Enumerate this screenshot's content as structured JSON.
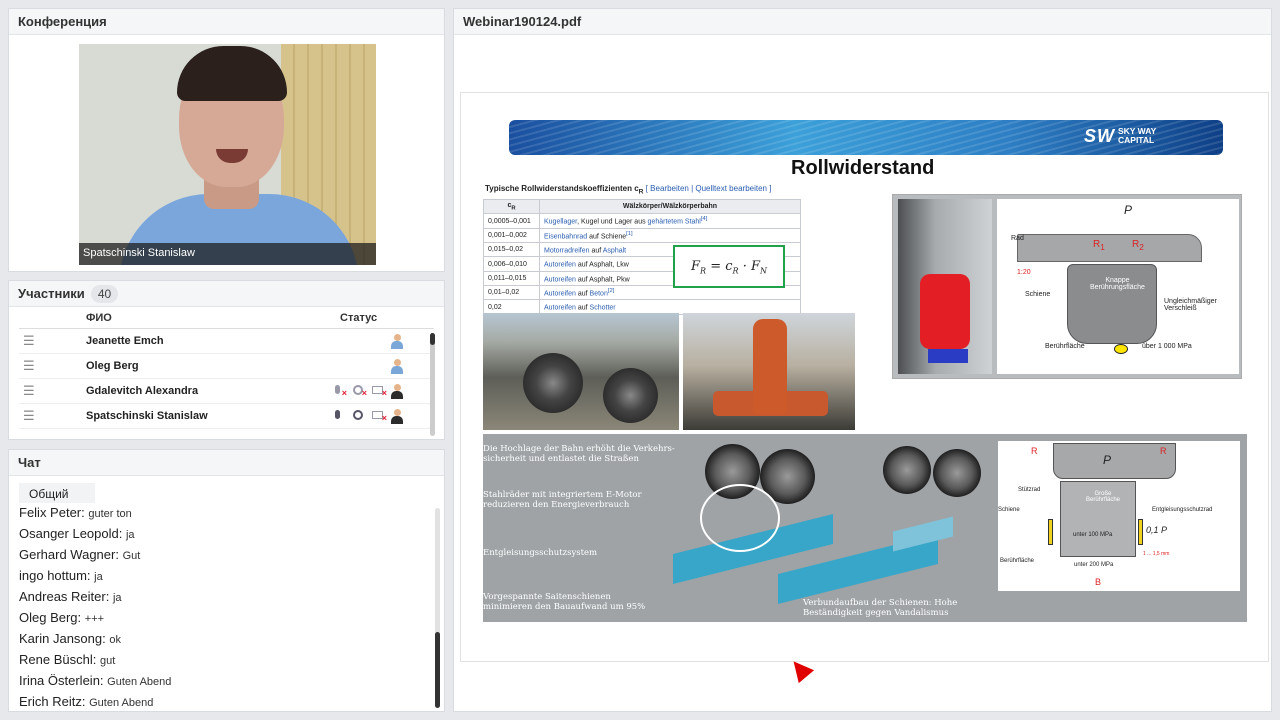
{
  "conference": {
    "title": "Конференция",
    "video_caption": "Spatschinski Stanislaw"
  },
  "participants": {
    "title": "Участники",
    "count": "40",
    "col_name": "ФИО",
    "col_status": "Статус",
    "rows": [
      {
        "name": "Jeanette Emch",
        "mic": false,
        "cam": false,
        "screen": false
      },
      {
        "name": "Oleg Berg",
        "mic": false,
        "cam": false,
        "screen": false
      },
      {
        "name": "Gdalevitch Alexandra",
        "mic": "muted",
        "cam": "off",
        "screen": "off"
      },
      {
        "name": "Spatschinski Stanislaw",
        "mic": "on",
        "cam": "on",
        "screen": "off"
      }
    ]
  },
  "chat": {
    "title": "Чат",
    "tab": "Общий",
    "messages": [
      {
        "who": "Felix Peter:",
        "msg": "guter ton"
      },
      {
        "who": "Osanger Leopold:",
        "msg": "ja"
      },
      {
        "who": "Gerhard Wagner:",
        "msg": "Gut"
      },
      {
        "who": "ingo hottum:",
        "msg": "ja"
      },
      {
        "who": "Andreas Reiter:",
        "msg": "ja"
      },
      {
        "who": "Oleg Berg:",
        "msg": "+++"
      },
      {
        "who": "Karin Jansong:",
        "msg": "ok"
      },
      {
        "who": "Rene Büschl:",
        "msg": "gut"
      },
      {
        "who": "Irina Österlein:",
        "msg": "Guten Abend"
      },
      {
        "who": "Erich Reitz:",
        "msg": "Guten Abend"
      }
    ]
  },
  "pdf": {
    "title": "Webinar190124.pdf",
    "slide": {
      "logo_mark": "SW",
      "logo_line1": "SKY WAY",
      "logo_line2": "CAPITAL",
      "title": "Rollwiderstand",
      "table_title": "Typische Rollwiderstandskoeffizienten c",
      "table_title_sub": "R",
      "table_links": "[ Bearbeiten | Quelltext bearbeiten ]",
      "table_head_c": "c",
      "table_head_c_sub": "R",
      "table_head_pair": "Wälzkörper/Wälzkörperbahn",
      "table_rows": [
        {
          "c": "0,0005–0,001",
          "link": "Kugellager",
          "rest": ", Kugel und Lager aus ",
          "link2": "gehärtetem Stahl",
          "sup": "[4]"
        },
        {
          "c": "0,001–0,002",
          "link": "Eisenbahnrad",
          "rest": " auf Schiene",
          "link2": "",
          "sup": "[1]"
        },
        {
          "c": "0,015–0,02",
          "link": "Motorradreifen",
          "rest": " auf ",
          "link2": "Asphalt",
          "sup": ""
        },
        {
          "c": "0,006–0,010",
          "link": "Autoreifen",
          "rest": " auf Asphalt, Lkw",
          "link2": "",
          "sup": ""
        },
        {
          "c": "0,011–0,015",
          "link": "Autoreifen",
          "rest": " auf Asphalt, Pkw",
          "link2": "",
          "sup": ""
        },
        {
          "c": "0,01–0,02",
          "link": "Autoreifen",
          "rest": " auf ",
          "link2": "Beton",
          "sup": "[2]"
        },
        {
          "c": "0,02",
          "link": "Autoreifen",
          "rest": " auf ",
          "link2": "Schotter",
          "sup": ""
        }
      ],
      "formula_lhs": "F",
      "formula_lhs_sub": "R",
      "formula_mid": "= c",
      "formula_mid_sub": "R",
      "formula_rhs": "· F",
      "formula_rhs_sub": "N",
      "diagram1": {
        "p": "P",
        "rad": "Rad",
        "r1": "R",
        "r1_sub": "1",
        "r2": "R",
        "r2_sub": "2",
        "ratio": "1:20",
        "knappe": "Knappe\nBerührungsfläche",
        "schiene": "Schiene",
        "verschleiss": "Ungleichmäßiger\nVerschleiß",
        "flaeche": "Berührfläche",
        "pressure": "über 1 000 MPa"
      },
      "diagram2": {
        "t1": "Die Hochlage der Bahn erhöht die Verkehrs-\nsicherheit und entlastet die Straßen",
        "t2": "Stahlräder mit integriertem E-Motor\nreduzieren den Energieverbrauch",
        "t3": "Entgleisungsschutzsystem",
        "t4": "Vorgespannte Saitenschienen\nminimieren den Bauaufwand um 95%",
        "t5": "Verbundaufbau der Schienen: Hohe\nBeständigkeit gegen Vandalismus"
      },
      "schema": {
        "r_left": "R",
        "r_right": "R",
        "p": "P",
        "stuetzrad": "Stützrad",
        "grosse": "Große\nBerührfläche",
        "schiene": "Schiene",
        "entgl": "Entgleisungsschutzrad",
        "p100": "unter 100 MPa",
        "p01": "0,1 P",
        "flaeche": "Berührfläche",
        "p200": "unter 200 MPa",
        "b": "B",
        "range": "1 ... 1,5 mm"
      }
    }
  }
}
